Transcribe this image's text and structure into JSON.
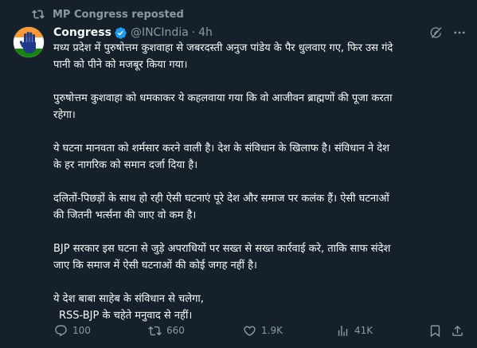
{
  "repost": {
    "label": "MP Congress reposted"
  },
  "author": {
    "name": "Congress",
    "handle": "@INCIndia",
    "separator": "·",
    "time": "4h"
  },
  "tweet": {
    "paragraphs": [
      [
        "मध्य प्रदेश में पुरुषोत्तम कुशवाहा से जबरदस्ती अनुज पांडेय के पैर धुलवाए गए, फिर उस गंदे",
        "पानी को पीने को मजबूर किया गया।"
      ],
      [
        "पुरुषोत्तम कुशवाहा को धमकाकर ये कहलवाया गया कि वो आजीवन ब्राह्मणों की पूजा करता",
        "रहेगा।"
      ],
      [
        "ये घटना मानवता को शर्मसार करने वाली है। देश के संविधान के खिलाफ है। संविधान ने देश",
        "के हर नागरिक को समान दर्जा दिया है।"
      ],
      [
        "दलितों-पिछड़ों के साथ हो रही ऐसी घटनाएं पूरे देश और समाज पर कलंक हैं। ऐसी घटनाओं",
        "की जितनी भर्त्सना की जाए वो कम है।"
      ],
      [
        "BJP सरकार इस घटना से जुड़े अपराधियों पर सख्त से सख्त कार्रवाई करे, ताकि साफ संदेश",
        "जाए कि समाज में ऐसी घटनाओं की कोई जगह नहीं है।"
      ],
      [
        "ये देश बाबा साहेब के संविधान से चलेगा,",
        "RSS-BJP के चहेते मनुवाद से नहीं।"
      ]
    ]
  },
  "stats": {
    "replies": "100",
    "reposts": "660",
    "likes": "1.9K",
    "views": "41K"
  },
  "colors": {
    "background": "#15202b",
    "text": "#f7f9f9",
    "muted": "#8b98a5",
    "verified": "#1d9bf0"
  }
}
